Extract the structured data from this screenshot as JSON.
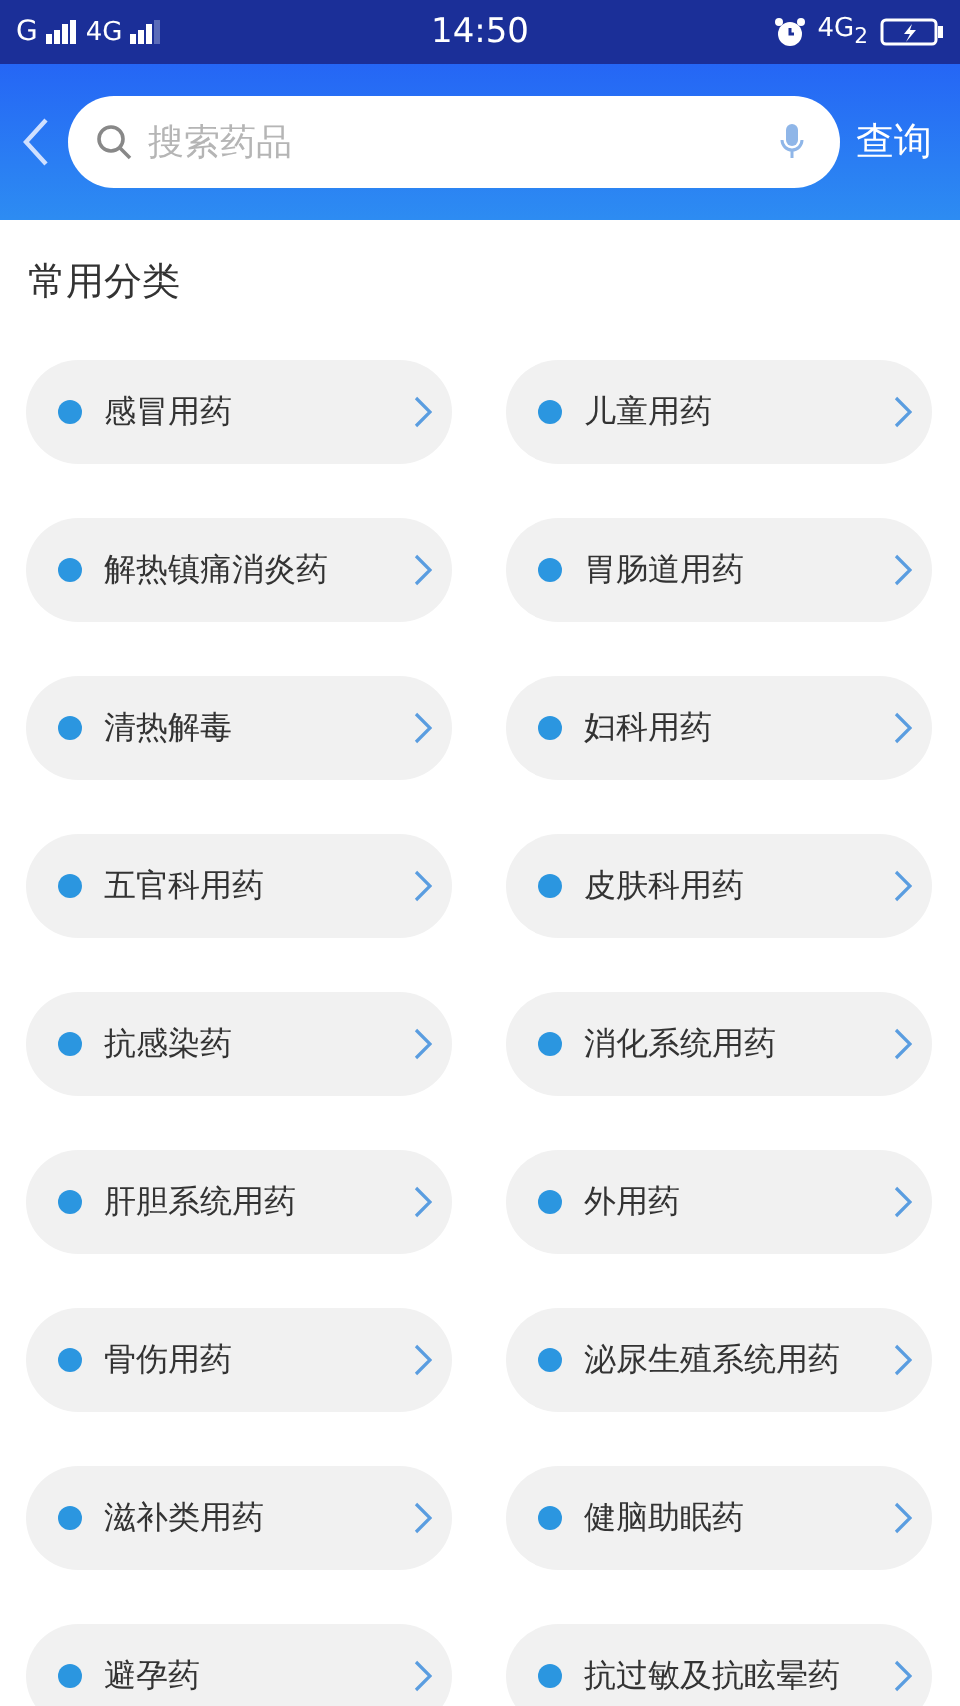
{
  "status_bar": {
    "signal_1": "G",
    "signal_2": "4G",
    "time": "14:50",
    "network": "4G$_{2}$"
  },
  "search": {
    "placeholder": "搜索药品",
    "submit": "查询"
  },
  "section_title": "常用分类",
  "categories": [
    {
      "label": "感冒用药"
    },
    {
      "label": "儿童用药"
    },
    {
      "label": "解热镇痛消炎药"
    },
    {
      "label": "胃肠道用药"
    },
    {
      "label": "清热解毒"
    },
    {
      "label": "妇科用药"
    },
    {
      "label": "五官科用药"
    },
    {
      "label": "皮肤科用药"
    },
    {
      "label": "抗感染药"
    },
    {
      "label": "消化系统用药"
    },
    {
      "label": "肝胆系统用药"
    },
    {
      "label": "外用药"
    },
    {
      "label": "骨伤用药"
    },
    {
      "label": "泌尿生殖系统用药"
    },
    {
      "label": "滋补类用药"
    },
    {
      "label": "健脑助眠药"
    },
    {
      "label": "避孕药"
    },
    {
      "label": "抗过敏及抗眩晕药"
    }
  ]
}
